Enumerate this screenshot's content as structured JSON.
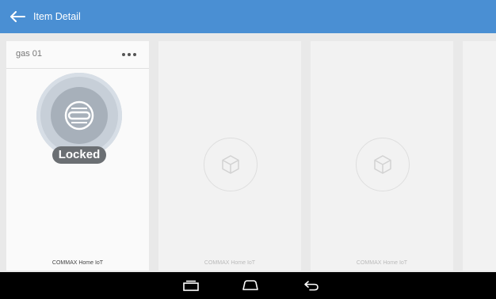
{
  "appbar": {
    "title": "Item Detail",
    "icons": {
      "back": "arrow-left-icon"
    },
    "color": "#4a8fd3"
  },
  "cards": [
    {
      "title": "gas 01",
      "status": "Locked",
      "footer": "COMMAX Home IoT",
      "icons": {
        "device": "gas-valve-icon",
        "menu": "more-horizontal-icon"
      }
    },
    {
      "footer": "COMMAX Home IoT",
      "icons": {
        "placeholder": "cube-icon"
      }
    },
    {
      "footer": "COMMAX Home IoT",
      "icons": {
        "placeholder": "cube-icon"
      }
    }
  ],
  "navbar": {
    "icons": {
      "recents": "recents-icon",
      "home": "home-icon",
      "back": "back-icon"
    },
    "color": "#000000"
  }
}
